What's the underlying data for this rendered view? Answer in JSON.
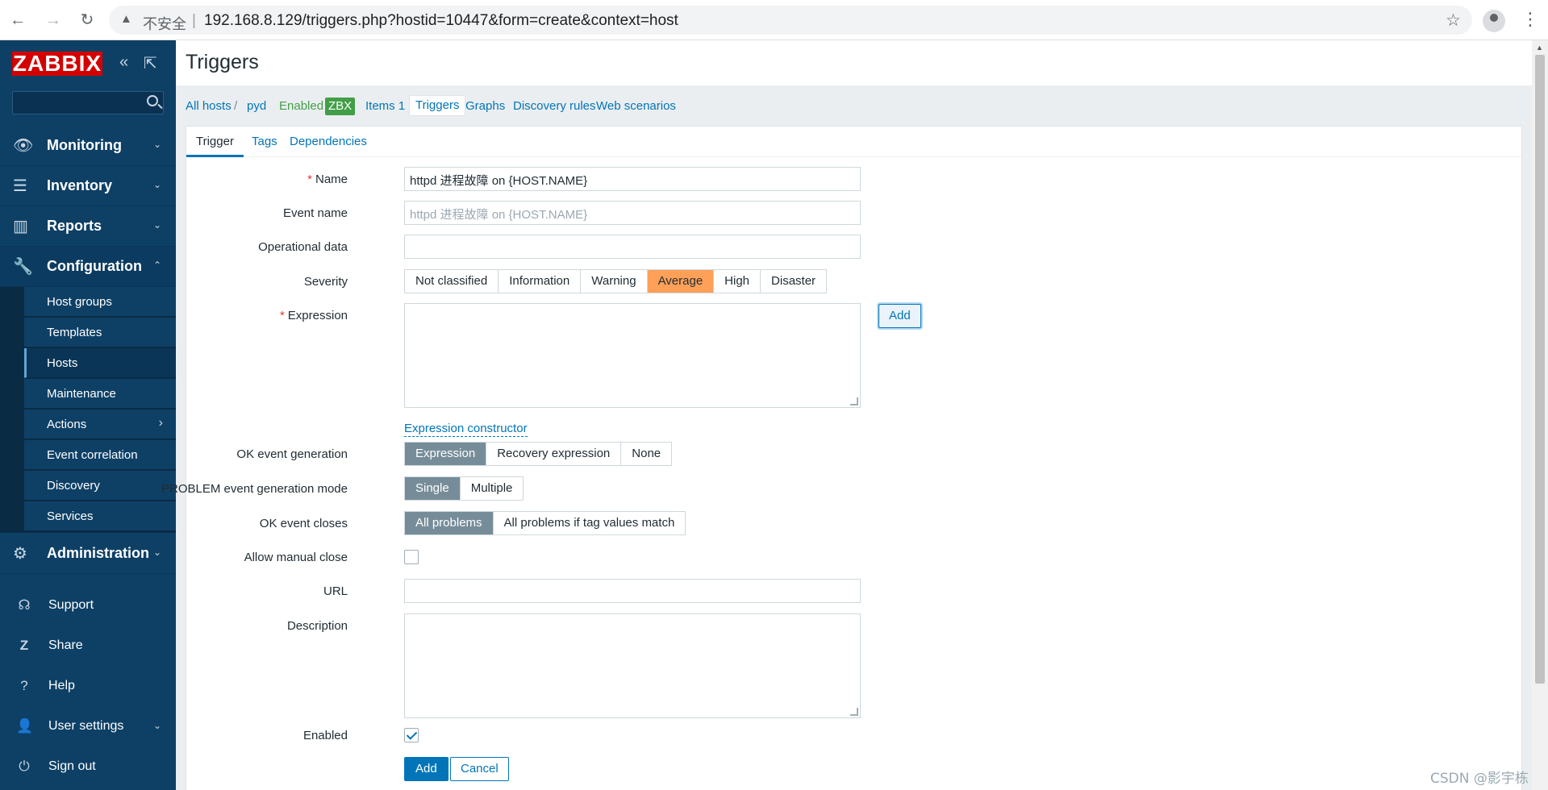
{
  "browser": {
    "insecure_label": "不安全",
    "separator": "|",
    "url": "192.168.8.129/triggers.php?hostid=10447&form=create&context=host",
    "back_icon": "←",
    "forward_icon": "→",
    "reload_icon": "↻",
    "star_icon": "☆",
    "menu_icon": "⋮",
    "warning_icon": "▲"
  },
  "sidebar": {
    "logo": "ZABBIX",
    "collapse_icon": "«",
    "kiosk_icon": "⇱",
    "sections": [
      {
        "label": "Monitoring",
        "icon": "👁",
        "chevron": "⌄"
      },
      {
        "label": "Inventory",
        "icon": "☰",
        "chevron": "⌄"
      },
      {
        "label": "Reports",
        "icon": "▥",
        "chevron": "⌄"
      },
      {
        "label": "Configuration",
        "icon": "🔧",
        "chevron": "⌃"
      },
      {
        "label": "Administration",
        "icon": "⚙",
        "chevron": "⌄"
      }
    ],
    "config_items": [
      {
        "label": "Host groups"
      },
      {
        "label": "Templates"
      },
      {
        "label": "Hosts"
      },
      {
        "label": "Maintenance"
      },
      {
        "label": "Actions",
        "chevron": "›"
      },
      {
        "label": "Event correlation"
      },
      {
        "label": "Discovery"
      },
      {
        "label": "Services"
      }
    ],
    "footer": [
      {
        "label": "Support",
        "icon": "☊"
      },
      {
        "label": "Share",
        "icon": "Z"
      },
      {
        "label": "Help",
        "icon": "?"
      },
      {
        "label": "User settings",
        "icon": "👤",
        "chevron": "⌄"
      },
      {
        "label": "Sign out",
        "icon": "⏻"
      }
    ]
  },
  "page": {
    "title": "Triggers"
  },
  "breadcrumbs": {
    "all_hosts": "All hosts",
    "slash": "/",
    "host": "pyd",
    "status": "Enabled",
    "zbx": "ZBX",
    "items": "Items 1",
    "triggers": "Triggers",
    "graphs": "Graphs",
    "discovery": "Discovery rules",
    "web": "Web scenarios"
  },
  "tabs": [
    "Trigger",
    "Tags",
    "Dependencies"
  ],
  "form": {
    "required_mark": "*",
    "name_label": "Name",
    "name_value": "httpd 进程故障 on {HOST.NAME}",
    "event_name_label": "Event name",
    "event_name_placeholder": "httpd 进程故障 on {HOST.NAME}",
    "opdata_label": "Operational data",
    "opdata_value": "",
    "severity_label": "Severity",
    "severity_options": [
      "Not classified",
      "Information",
      "Warning",
      "Average",
      "High",
      "Disaster"
    ],
    "severity_selected": "Average",
    "expression_label": "Expression",
    "expression_add": "Add",
    "expression_constructor": "Expression constructor",
    "ok_gen_label": "OK event generation",
    "ok_gen_options": [
      "Expression",
      "Recovery expression",
      "None"
    ],
    "problem_mode_label": "PROBLEM event generation mode",
    "problem_mode_options": [
      "Single",
      "Multiple"
    ],
    "ok_closes_label": "OK event closes",
    "ok_closes_options": [
      "All problems",
      "All problems if tag values match"
    ],
    "manual_close_label": "Allow manual close",
    "manual_close_checked": false,
    "url_label": "URL",
    "url_value": "",
    "description_label": "Description",
    "enabled_label": "Enabled",
    "enabled_checked": true,
    "add_button": "Add",
    "cancel_button": "Cancel"
  },
  "watermark": "CSDN @影宇栋",
  "colors": {
    "sidebar_bg": "#0e4066",
    "link": "#0275b8",
    "severity_average": "#ffa059",
    "selected_segment": "#768d99",
    "enabled_green": "#429e47",
    "logo_red": "#d40000"
  }
}
